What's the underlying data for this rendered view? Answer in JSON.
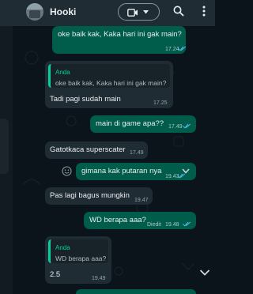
{
  "header": {
    "contact_name": "Hooki",
    "icons": {
      "video": "video-call-icon",
      "dropdown": "chevron-down-icon",
      "search": "search-icon",
      "menu": "more-vertical-icon"
    }
  },
  "messages": [
    {
      "dir": "out",
      "text": "oke baik kak, Kaka hari ini gak main?",
      "time": "17.24",
      "status": "read"
    },
    {
      "dir": "in",
      "quote_author": "Anda",
      "quote_text": "oke baik kak, Kaka hari ini gak main?",
      "text": "Tadi pagi sudah main",
      "time": "17.25"
    },
    {
      "dir": "out",
      "text": "main di game apa??",
      "time": "17.49",
      "status": "read"
    },
    {
      "dir": "in",
      "text": "Gatotkaca superscater",
      "time": "17.49"
    },
    {
      "dir": "out",
      "text": "gimana kak putaran nya",
      "time": "19.43",
      "status": "read"
    },
    {
      "dir": "in",
      "text": "Pas lagi bagus mungkin",
      "time": "19.47"
    },
    {
      "dir": "out",
      "text": "WD berapa aaa?",
      "edited": "Diedit",
      "time": "19.48",
      "status": "read"
    },
    {
      "dir": "in",
      "quote_author": "Anda",
      "quote_text": "WD berapa aaa?",
      "text": "2.5",
      "time": "19.49"
    }
  ],
  "colors": {
    "outgoing": "#005c4b",
    "incoming": "#1f2c34",
    "background": "#0b141a",
    "accent": "#06cf9c",
    "read_ticks": "#53bdeb"
  }
}
